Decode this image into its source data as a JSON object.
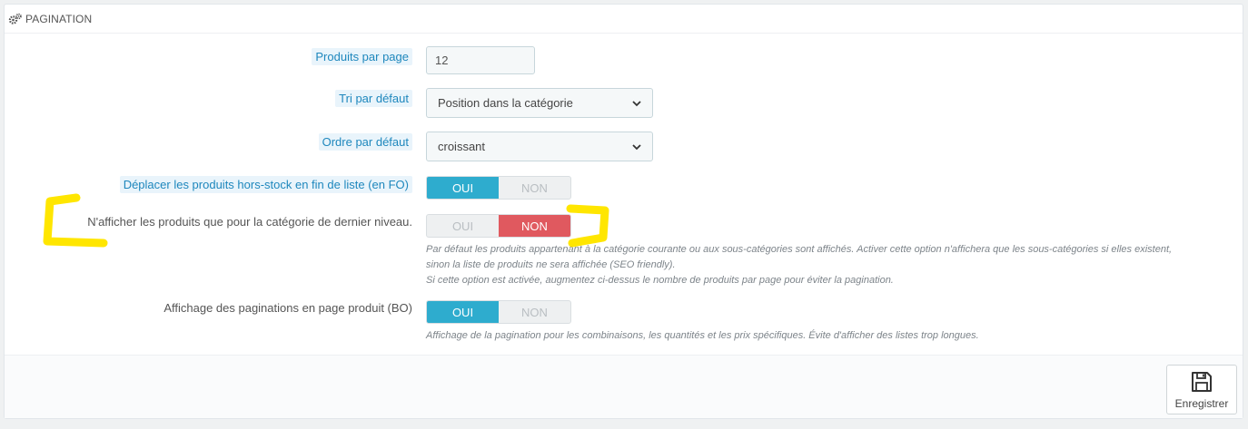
{
  "panel": {
    "title": "PAGINATION",
    "icon": "cogs-icon"
  },
  "fields": {
    "products_per_page": {
      "label": "Produits par page",
      "value": "12"
    },
    "default_sort": {
      "label": "Tri par défaut",
      "value": "Position dans la catégorie"
    },
    "default_order": {
      "label": "Ordre par défaut",
      "value": "croissant"
    },
    "out_of_stock_end": {
      "label": "Déplacer les produits hors-stock en fin de liste (en FO)",
      "yes": "OUI",
      "no": "NON",
      "selected": "OUI"
    },
    "last_level_category": {
      "label": "N'afficher les produits que pour la catégorie de dernier niveau.",
      "yes": "OUI",
      "no": "NON",
      "selected": "NON",
      "help_line1": "Par défaut les produits appartenant à la catégorie courante ou aux sous-catégories sont affichés. Activer cette option n'affichera que les sous-catégories si elles existent,",
      "help_line2": "sinon la liste de produits ne sera affichée (SEO friendly).",
      "help_line3": "Si cette option est activée, augmentez ci-dessus le nombre de produits par page pour éviter la pagination."
    },
    "bo_pagination": {
      "label": "Affichage des paginations en page produit (BO)",
      "yes": "OUI",
      "no": "NON",
      "selected": "OUI",
      "help": "Affichage de la pagination pour les combinaisons, les quantités et les prix spécifiques. Évite d'afficher des listes trop longues."
    }
  },
  "footer": {
    "save_label": "Enregistrer",
    "save_icon": "floppy-disk-icon"
  },
  "colors": {
    "accent_yes": "#2eacce",
    "accent_no": "#e0595f",
    "tooltip_label": "#1e87bd",
    "highlight_marker": "#ffe600"
  }
}
